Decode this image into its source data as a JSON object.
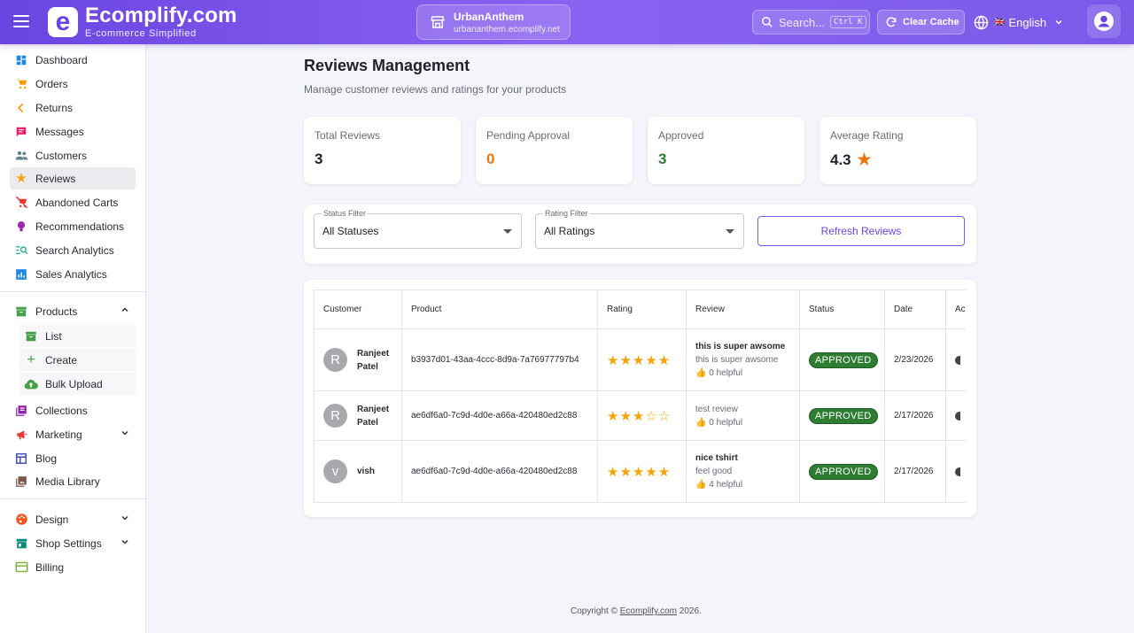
{
  "header": {
    "brand_name": "Ecomplify.com",
    "brand_tagline": "E-commerce Simplified",
    "store_name": "UrbanAnthem",
    "store_url": "urbananthem.ecomplify.net",
    "search_placeholder": "Search...",
    "search_shortcut": "Ctrl K",
    "clear_cache_label": "Clear Cache",
    "language_flag": "🇬🇧",
    "language_label": "English"
  },
  "sidebar": {
    "items": [
      {
        "label": "Dashboard",
        "icon": "dashboard-icon"
      },
      {
        "label": "Orders",
        "icon": "cart-icon"
      },
      {
        "label": "Returns",
        "icon": "chevron-left-icon"
      },
      {
        "label": "Messages",
        "icon": "message-icon"
      },
      {
        "label": "Customers",
        "icon": "people-icon"
      },
      {
        "label": "Reviews",
        "icon": "star-icon"
      },
      {
        "label": "Abandoned Carts",
        "icon": "remove-cart-icon"
      },
      {
        "label": "Recommendations",
        "icon": "lightbulb-icon"
      },
      {
        "label": "Search Analytics",
        "icon": "search-analytics-icon"
      },
      {
        "label": "Sales Analytics",
        "icon": "chart-icon"
      }
    ],
    "products": {
      "label": "Products",
      "sub_items": [
        {
          "label": "List"
        },
        {
          "label": "Create"
        },
        {
          "label": "Bulk Upload"
        }
      ]
    },
    "items2": [
      {
        "label": "Collections"
      },
      {
        "label": "Marketing"
      },
      {
        "label": "Blog"
      },
      {
        "label": "Media Library"
      }
    ],
    "items3": [
      {
        "label": "Design"
      },
      {
        "label": "Shop Settings"
      },
      {
        "label": "Billing"
      }
    ]
  },
  "main": {
    "title": "Reviews Management",
    "subtitle": "Manage customer reviews and ratings for your products",
    "stats": [
      {
        "label": "Total Reviews",
        "value": "3",
        "color": "#22222b"
      },
      {
        "label": "Pending Approval",
        "value": "0",
        "color": "#e8770e"
      },
      {
        "label": "Approved",
        "value": "3",
        "color": "#2e7d32"
      },
      {
        "label": "Average Rating",
        "value": "4.3",
        "color": "#22222b"
      }
    ],
    "filters": {
      "status_label": "Status Filter",
      "status_value": "All Statuses",
      "rating_label": "Rating Filter",
      "rating_value": "All Ratings",
      "refresh_label": "Refresh Reviews"
    },
    "table": {
      "headers": [
        "Customer",
        "Product",
        "Rating",
        "Review",
        "Status",
        "Date",
        "Actions"
      ],
      "rows": [
        {
          "initial": "R",
          "customer_line1": "Ranjeet",
          "customer_line2": "Patel",
          "product": "b3937d01-43aa-4ccc-8d9a-7a76977797b4",
          "rating": 5,
          "review_title": "this is super awsome",
          "review_body": "this is super awsome",
          "helpful": "👍 0 helpful",
          "status": "APPROVED",
          "date": "2/23/2026"
        },
        {
          "initial": "R",
          "customer_line1": "Ranjeet",
          "customer_line2": "Patel",
          "product": "ae6df6a0-7c9d-4d0e-a66a-420480ed2c88",
          "rating": 3,
          "review_title": "",
          "review_body": "test review",
          "helpful": "👍 0 helpful",
          "status": "APPROVED",
          "date": "2/17/2026"
        },
        {
          "initial": "v",
          "customer_line1": "vish",
          "customer_line2": "",
          "product": "ae6df6a0-7c9d-4d0e-a66a-420480ed2c88",
          "rating": 5,
          "review_title": "nice tshirt",
          "review_body": "feel good",
          "helpful": "👍 4 helpful",
          "status": "APPROVED",
          "date": "2/17/2026"
        }
      ]
    }
  },
  "footer": {
    "prefix": "Copyright ©",
    "link": "Ecomplify.com",
    "suffix": "2026."
  },
  "colors": {
    "brand": "#6a45e0",
    "approved": "#2e7d32",
    "pending": "#e8770e",
    "star": "#f2a40a"
  }
}
